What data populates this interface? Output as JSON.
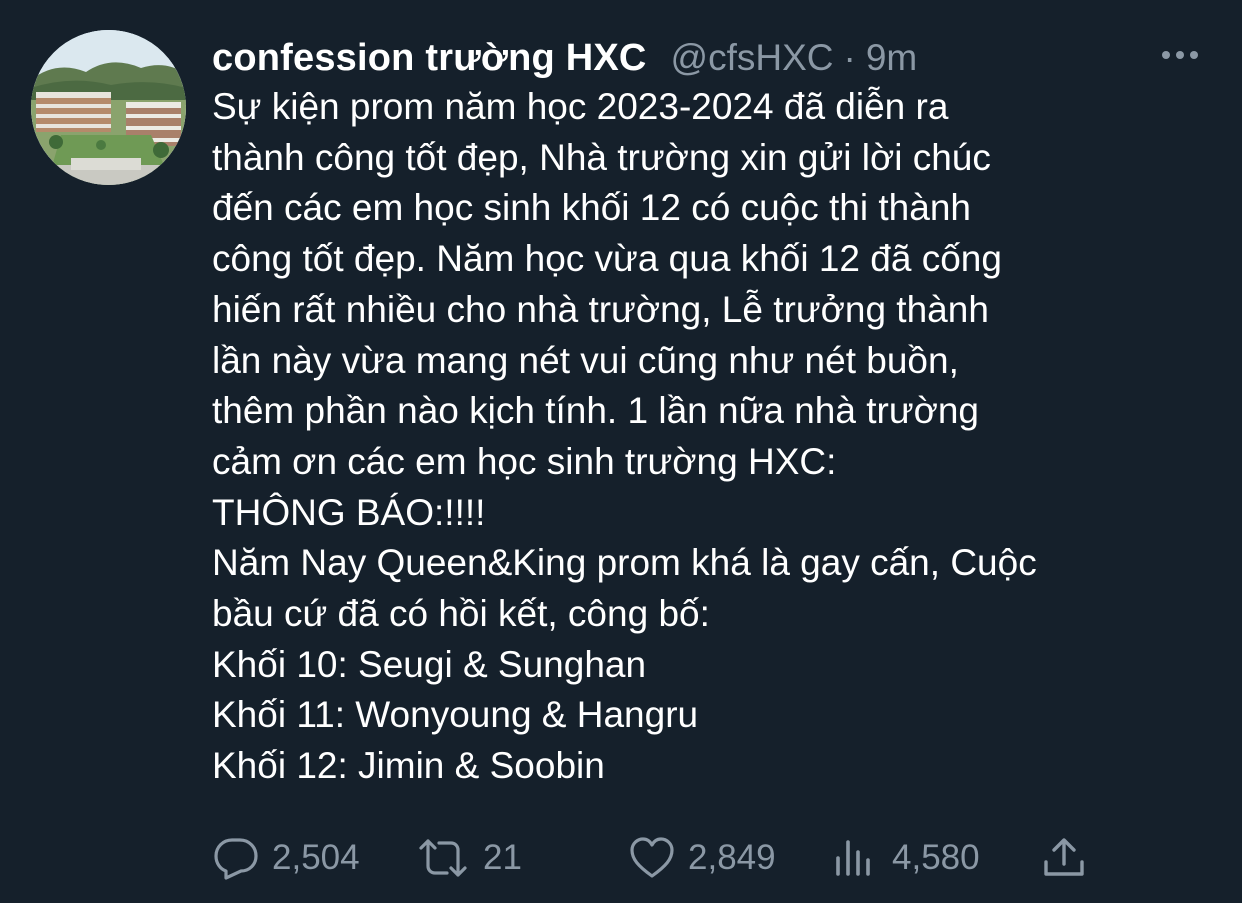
{
  "tweet": {
    "display_name": "confession trường HXC",
    "handle": "@cfsHXC",
    "separator": "·",
    "time": "9m",
    "text_lines": [
      "Sự kiện prom năm học 2023-2024 đã diễn ra",
      "thành công tốt đẹp, Nhà trường xin gửi lời chúc",
      "đến các em học sinh khối 12 có cuộc thi thành",
      "công tốt đẹp. Năm học vừa qua khối 12 đã cống",
      "hiến rất nhiều cho nhà trường, Lễ trưởng thành",
      "lần này vừa mang nét vui cũng như nét buồn,",
      "thêm phần nào kịch tính. 1 lần nữa nhà trường",
      "cảm ơn các em học sinh trường HXC:",
      "THÔNG BÁO:!!!!",
      "Năm Nay Queen&King prom khá là gay cấn, Cuộc",
      "bầu cứ đã có hồi kết, công bố:",
      "Khối 10: Seugi & Sunghan",
      "Khối 11: Wonyoung & Hangru",
      "Khối 12: Jimin & Soobin"
    ],
    "more_icon": "more-horizontal-icon",
    "actions": {
      "reply": {
        "icon": "reply-icon",
        "count": "2,504"
      },
      "retweet": {
        "icon": "retweet-icon",
        "count": "21"
      },
      "like": {
        "icon": "heart-icon",
        "count": "2,849"
      },
      "views": {
        "icon": "views-chart-icon",
        "count": "4,580"
      },
      "share": {
        "icon": "share-icon"
      }
    }
  },
  "colors": {
    "background": "#15202b",
    "text": "#ffffff",
    "secondary_text": "#8b98a5"
  }
}
